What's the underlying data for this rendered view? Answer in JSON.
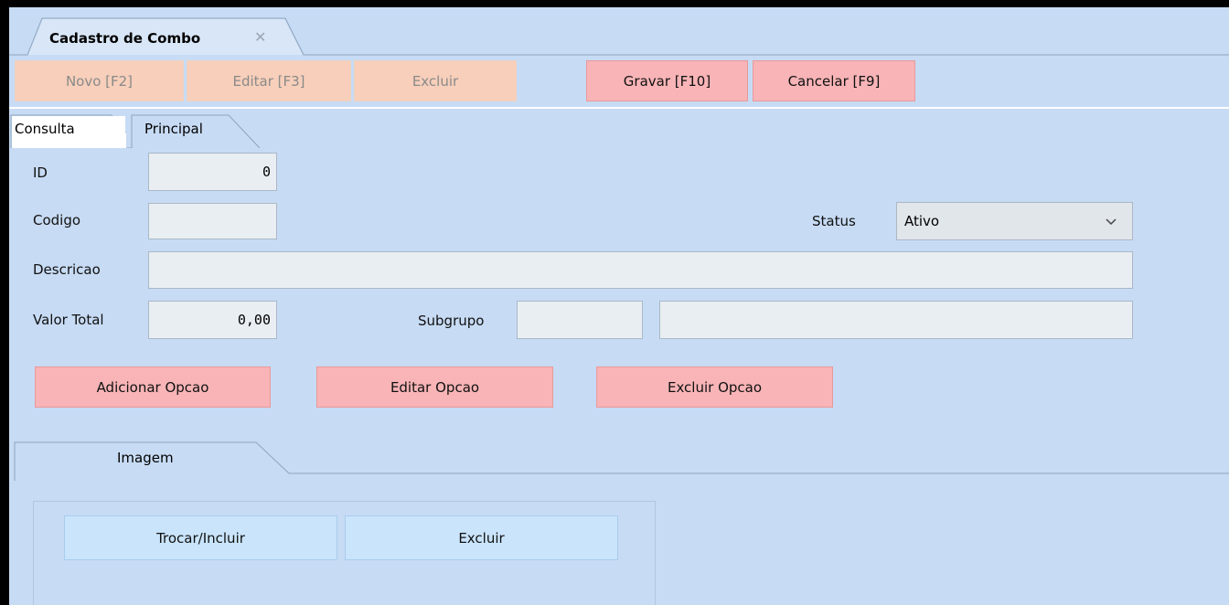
{
  "window_tab": {
    "title": "Cadastro de Combo",
    "close_glyph": "✕"
  },
  "toolbar": {
    "novo": "Novo [F2]",
    "editar": "Editar [F3]",
    "excluir": "Excluir",
    "gravar": "Gravar [F10]",
    "cancelar": "Cancelar [F9]"
  },
  "tabs": {
    "consulta": "Consulta",
    "principal": "Principal",
    "active": "Principal"
  },
  "form": {
    "id_label": "ID",
    "id_value": "0",
    "codigo_label": "Codigo",
    "codigo_value": "",
    "status_label": "Status",
    "status_value": "Ativo",
    "descricao_label": "Descricao",
    "descricao_value": "",
    "valor_total_label": "Valor Total",
    "valor_total_value": "0,00",
    "subgrupo_label": "Subgrupo",
    "subgrupo_value": "",
    "subgrupo_desc_value": ""
  },
  "opcao_buttons": {
    "adicionar": "Adicionar Opcao",
    "editar": "Editar Opcao",
    "excluir": "Excluir Opcao"
  },
  "image_section": {
    "tab_label": "Imagem",
    "trocar": "Trocar/Incluir",
    "excluir": "Excluir"
  },
  "icons": {
    "close": "close-icon",
    "dropdown": "chevron-down-icon",
    "lookup": "magnifier-icon"
  },
  "colors": {
    "background": "#c7dbf4",
    "disabled_button": "#f7cfba",
    "action_button": "#f8b4b6",
    "image_button": "#c9e4fb"
  }
}
